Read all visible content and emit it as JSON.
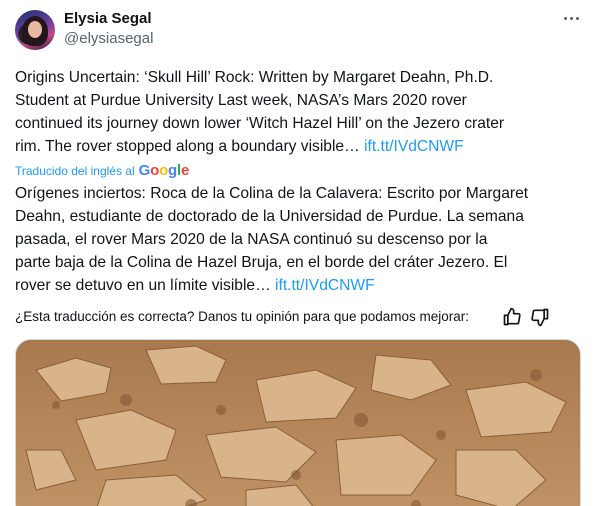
{
  "author": {
    "name": "Elysia Segal",
    "handle": "@elysiasegal"
  },
  "original": {
    "lines": [
      "Origins Uncertain: ‘Skull Hill’ Rock: Written by Margaret Deahn, Ph.D.",
      "Student at Purdue University Last week, NASA’s Mars 2020 rover",
      "continued its journey down lower ‘Witch Hazel Hill’ on the Jezero crater",
      "rim. The rover stopped along a boundary visible… "
    ],
    "link": "ift.tt/IVdCNWF"
  },
  "translation_notice": {
    "label": "Traducido del inglés al",
    "provider": [
      "G",
      "o",
      "o",
      "g",
      "l",
      "e"
    ]
  },
  "translated": {
    "lines": [
      "Orígenes inciertos: Roca de la Colina de la Calavera: Escrito por Margaret",
      "Deahn, estudiante de doctorado de la Universidad de Purdue. La semana",
      "pasada, el rover Mars 2020 de la NASA continuó su descenso por la",
      "parte baja de la Colina de Hazel Bruja, en el borde del cráter Jezero. El",
      "rover se detuvo en un límite visible… "
    ],
    "link": "ift.tt/IVdCNWF"
  },
  "feedback": {
    "question": "¿Esta traducción es correcta? Danos tu opinión para que podamos mejorar:"
  },
  "icons": {
    "more": "more-dots-icon",
    "like": "thumbs-up-icon",
    "dislike": "thumbs-down-icon"
  },
  "colors": {
    "link": "#1d9bf0",
    "secondary_text": "#536471",
    "rock_surface": "#b98a5c"
  }
}
